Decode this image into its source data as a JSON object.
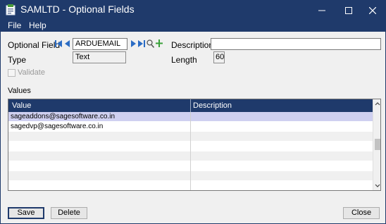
{
  "window": {
    "title": "SAMLTD - Optional Fields",
    "colors": {
      "titlebar": "#1f3a6b",
      "selected_row": "#cfd0f0",
      "alt_row": "#f0f0f0"
    }
  },
  "menu": {
    "items": [
      "File",
      "Help"
    ]
  },
  "form": {
    "optional_field_label": "Optional Field",
    "optional_field_value": "ARDUEMAIL",
    "description_label": "Description",
    "description_value": "",
    "type_label": "Type",
    "type_value": "Text",
    "length_label": "Length",
    "length_value": "60",
    "validate_label": "Validate",
    "validate_checked": false
  },
  "values_section": {
    "label": "Values",
    "columns": [
      "Value",
      "Description"
    ],
    "rows": [
      {
        "value": "sageaddons@sagesoftware.co.in",
        "description": "",
        "selected": true
      },
      {
        "value": "sagedvp@sagesoftware.co.in",
        "description": "",
        "selected": false
      },
      {
        "value": "",
        "description": "",
        "selected": false
      },
      {
        "value": "",
        "description": "",
        "selected": false
      },
      {
        "value": "",
        "description": "",
        "selected": false
      },
      {
        "value": "",
        "description": "",
        "selected": false
      },
      {
        "value": "",
        "description": "",
        "selected": false
      },
      {
        "value": "",
        "description": "",
        "selected": false
      }
    ]
  },
  "buttons": {
    "save": "Save",
    "delete": "Delete",
    "close": "Close"
  },
  "icons": {
    "first": "first-record-icon",
    "prev": "previous-record-icon",
    "next": "next-record-icon",
    "last": "last-record-icon",
    "finder": "finder-icon",
    "new": "new-record-icon"
  }
}
